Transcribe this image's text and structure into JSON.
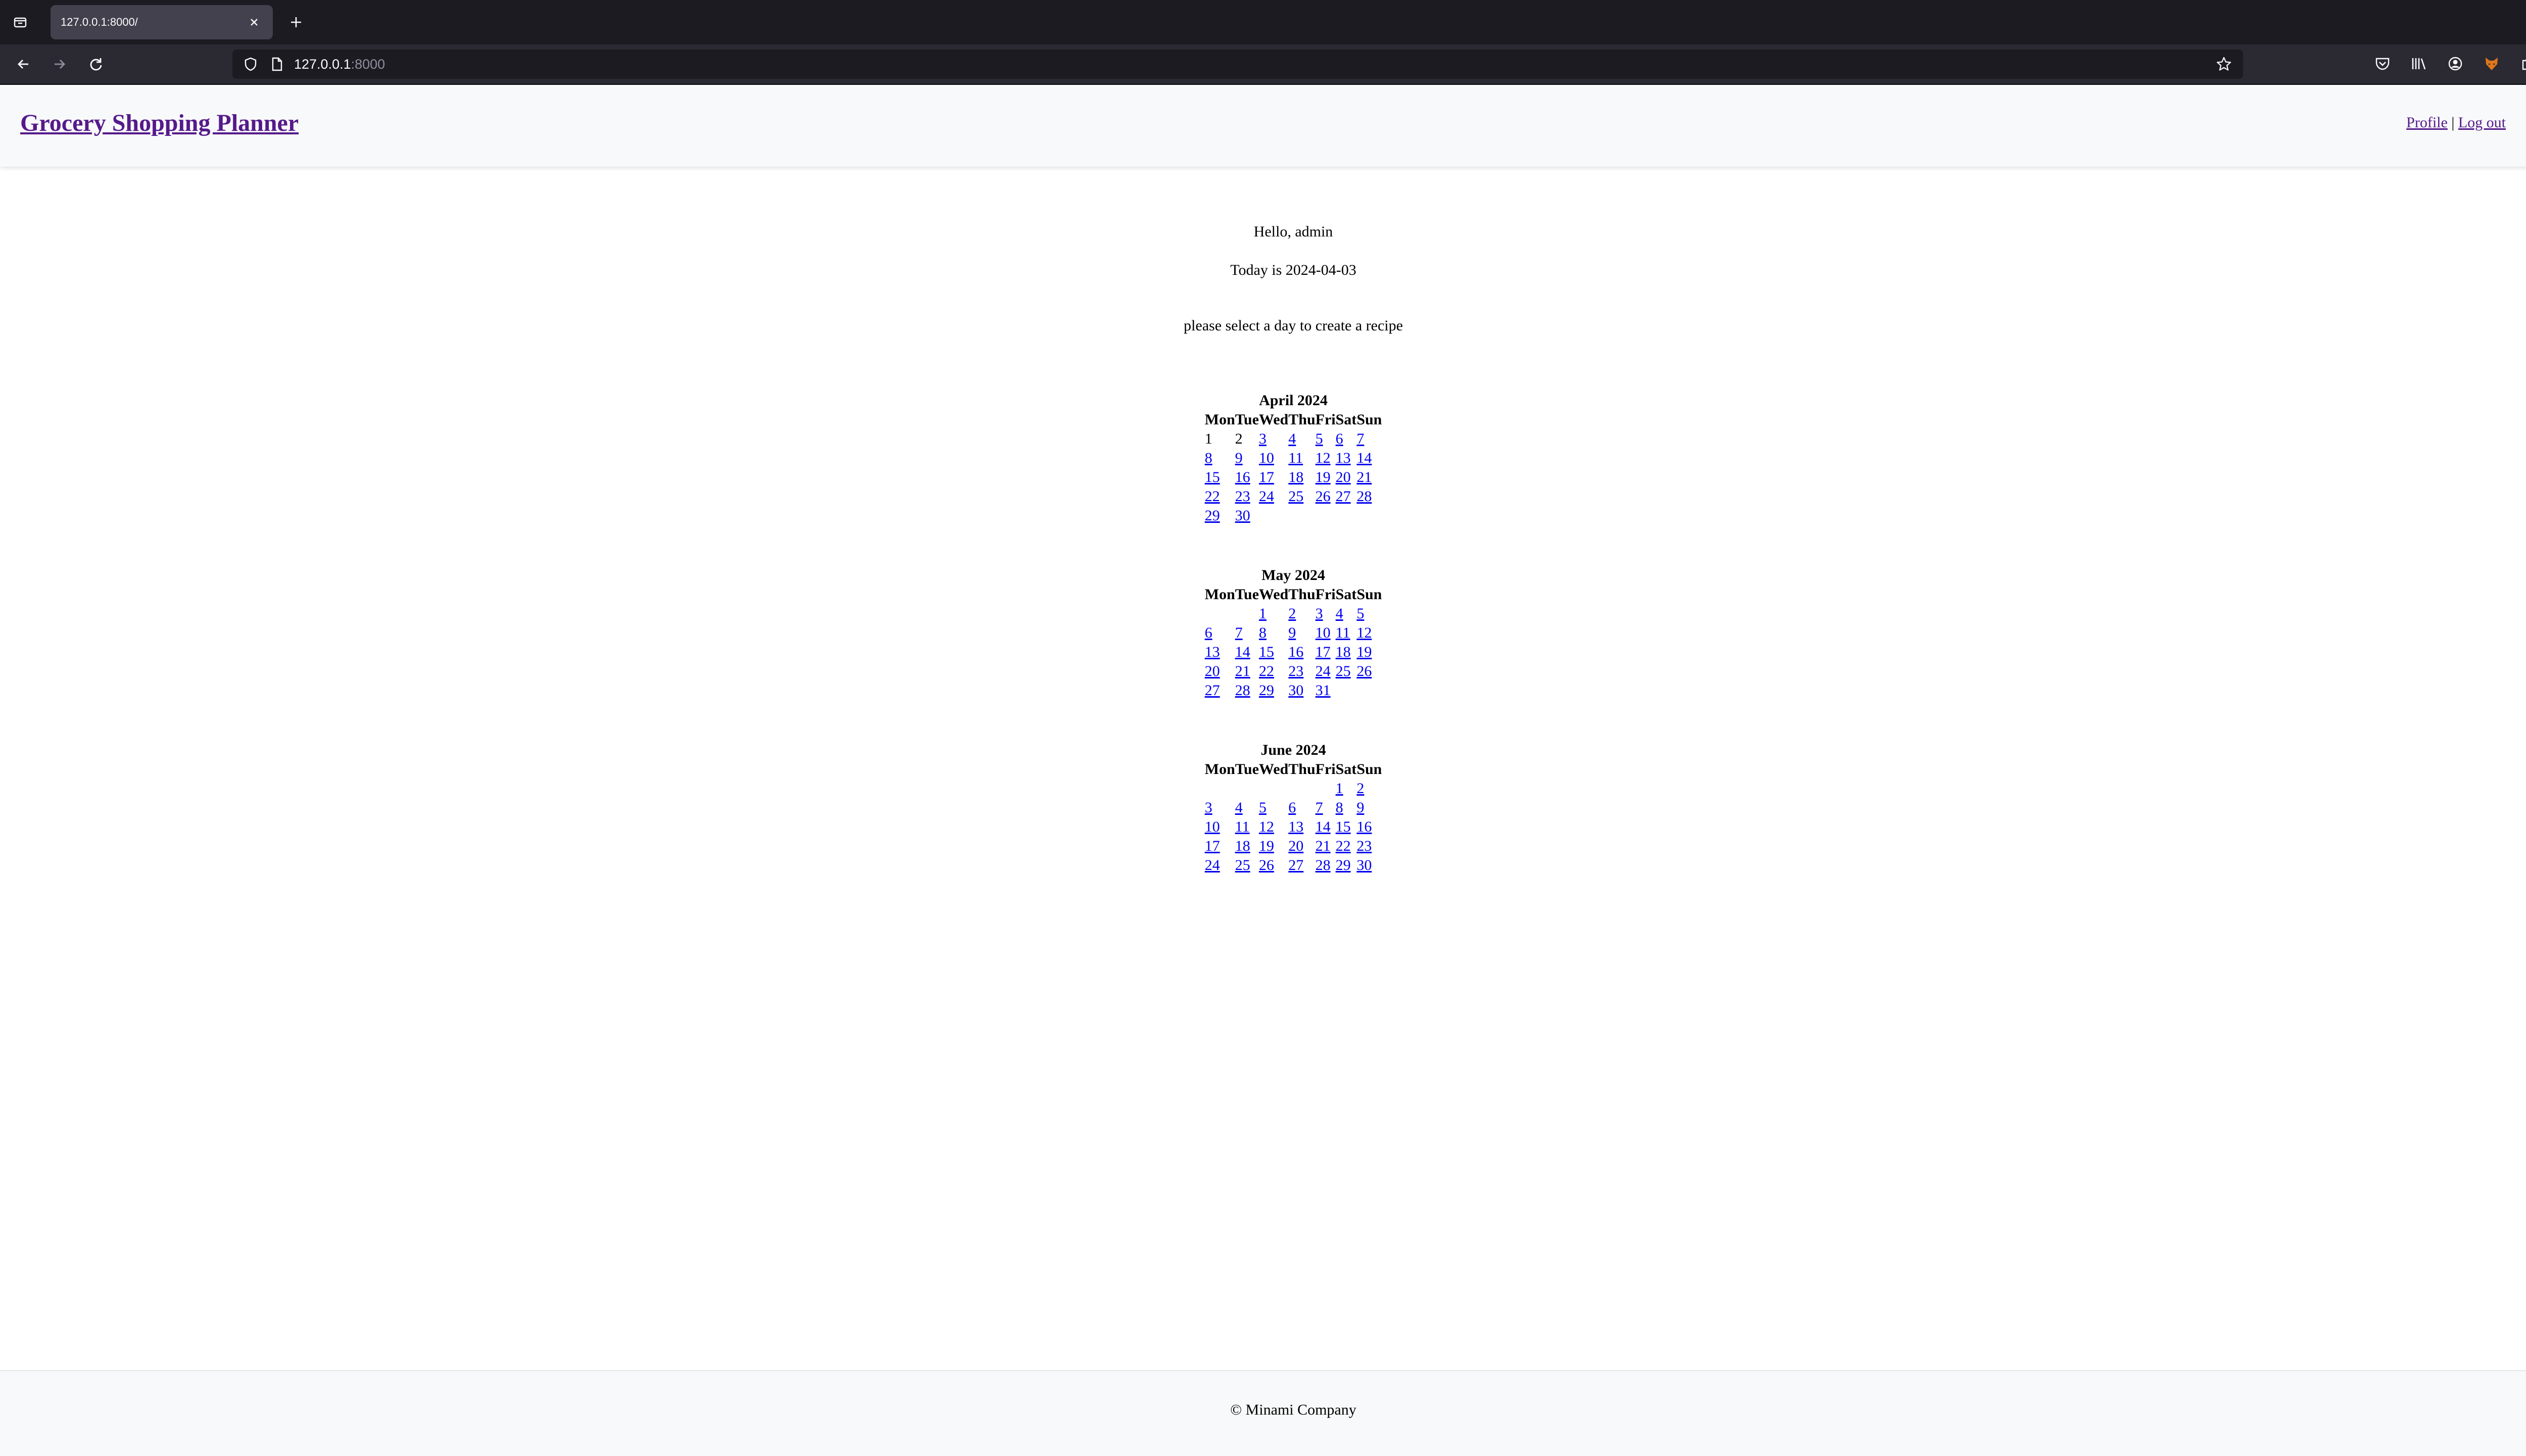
{
  "browser": {
    "tab_title": "127.0.0.1:8000/",
    "url_host": "127.0.0.1",
    "url_port": ":8000"
  },
  "header": {
    "title": "Grocery Shopping Planner",
    "profile_link": "Profile",
    "separator": "|",
    "logout_link": "Log out"
  },
  "main": {
    "greeting": "Hello, admin",
    "today": "Today is 2024-04-03",
    "instruction": "please select a day to create a recipe"
  },
  "calendars": [
    {
      "title": "April 2024",
      "weekdays": [
        "Mon",
        "Tue",
        "Wed",
        "Thu",
        "Fri",
        "Sat",
        "Sun"
      ],
      "weeks": [
        [
          {
            "d": "1",
            "link": false
          },
          {
            "d": "2",
            "link": false
          },
          {
            "d": "3",
            "link": true
          },
          {
            "d": "4",
            "link": true
          },
          {
            "d": "5",
            "link": true
          },
          {
            "d": "6",
            "link": true
          },
          {
            "d": "7",
            "link": true
          }
        ],
        [
          {
            "d": "8",
            "link": true
          },
          {
            "d": "9",
            "link": true
          },
          {
            "d": "10",
            "link": true
          },
          {
            "d": "11",
            "link": true
          },
          {
            "d": "12",
            "link": true
          },
          {
            "d": "13",
            "link": true
          },
          {
            "d": "14",
            "link": true
          }
        ],
        [
          {
            "d": "15",
            "link": true
          },
          {
            "d": "16",
            "link": true
          },
          {
            "d": "17",
            "link": true
          },
          {
            "d": "18",
            "link": true
          },
          {
            "d": "19",
            "link": true
          },
          {
            "d": "20",
            "link": true
          },
          {
            "d": "21",
            "link": true
          }
        ],
        [
          {
            "d": "22",
            "link": true
          },
          {
            "d": "23",
            "link": true
          },
          {
            "d": "24",
            "link": true
          },
          {
            "d": "25",
            "link": true
          },
          {
            "d": "26",
            "link": true
          },
          {
            "d": "27",
            "link": true
          },
          {
            "d": "28",
            "link": true
          }
        ],
        [
          {
            "d": "29",
            "link": true
          },
          {
            "d": "30",
            "link": true
          },
          {
            "d": "",
            "link": false
          },
          {
            "d": "",
            "link": false
          },
          {
            "d": "",
            "link": false
          },
          {
            "d": "",
            "link": false
          },
          {
            "d": "",
            "link": false
          }
        ]
      ]
    },
    {
      "title": "May 2024",
      "weekdays": [
        "Mon",
        "Tue",
        "Wed",
        "Thu",
        "Fri",
        "Sat",
        "Sun"
      ],
      "weeks": [
        [
          {
            "d": "",
            "link": false
          },
          {
            "d": "",
            "link": false
          },
          {
            "d": "1",
            "link": true
          },
          {
            "d": "2",
            "link": true
          },
          {
            "d": "3",
            "link": true
          },
          {
            "d": "4",
            "link": true
          },
          {
            "d": "5",
            "link": true
          }
        ],
        [
          {
            "d": "6",
            "link": true
          },
          {
            "d": "7",
            "link": true
          },
          {
            "d": "8",
            "link": true
          },
          {
            "d": "9",
            "link": true
          },
          {
            "d": "10",
            "link": true
          },
          {
            "d": "11",
            "link": true
          },
          {
            "d": "12",
            "link": true
          }
        ],
        [
          {
            "d": "13",
            "link": true
          },
          {
            "d": "14",
            "link": true
          },
          {
            "d": "15",
            "link": true
          },
          {
            "d": "16",
            "link": true
          },
          {
            "d": "17",
            "link": true
          },
          {
            "d": "18",
            "link": true
          },
          {
            "d": "19",
            "link": true
          }
        ],
        [
          {
            "d": "20",
            "link": true
          },
          {
            "d": "21",
            "link": true
          },
          {
            "d": "22",
            "link": true
          },
          {
            "d": "23",
            "link": true
          },
          {
            "d": "24",
            "link": true
          },
          {
            "d": "25",
            "link": true
          },
          {
            "d": "26",
            "link": true
          }
        ],
        [
          {
            "d": "27",
            "link": true
          },
          {
            "d": "28",
            "link": true
          },
          {
            "d": "29",
            "link": true
          },
          {
            "d": "30",
            "link": true
          },
          {
            "d": "31",
            "link": true
          },
          {
            "d": "",
            "link": false
          },
          {
            "d": "",
            "link": false
          }
        ]
      ]
    },
    {
      "title": "June 2024",
      "weekdays": [
        "Mon",
        "Tue",
        "Wed",
        "Thu",
        "Fri",
        "Sat",
        "Sun"
      ],
      "weeks": [
        [
          {
            "d": "",
            "link": false
          },
          {
            "d": "",
            "link": false
          },
          {
            "d": "",
            "link": false
          },
          {
            "d": "",
            "link": false
          },
          {
            "d": "",
            "link": false
          },
          {
            "d": "1",
            "link": true
          },
          {
            "d": "2",
            "link": true
          }
        ],
        [
          {
            "d": "3",
            "link": true
          },
          {
            "d": "4",
            "link": true
          },
          {
            "d": "5",
            "link": true
          },
          {
            "d": "6",
            "link": true
          },
          {
            "d": "7",
            "link": true
          },
          {
            "d": "8",
            "link": true
          },
          {
            "d": "9",
            "link": true
          }
        ],
        [
          {
            "d": "10",
            "link": true
          },
          {
            "d": "11",
            "link": true
          },
          {
            "d": "12",
            "link": true
          },
          {
            "d": "13",
            "link": true
          },
          {
            "d": "14",
            "link": true
          },
          {
            "d": "15",
            "link": true
          },
          {
            "d": "16",
            "link": true
          }
        ],
        [
          {
            "d": "17",
            "link": true
          },
          {
            "d": "18",
            "link": true
          },
          {
            "d": "19",
            "link": true
          },
          {
            "d": "20",
            "link": true
          },
          {
            "d": "21",
            "link": true
          },
          {
            "d": "22",
            "link": true
          },
          {
            "d": "23",
            "link": true
          }
        ],
        [
          {
            "d": "24",
            "link": true
          },
          {
            "d": "25",
            "link": true
          },
          {
            "d": "26",
            "link": true
          },
          {
            "d": "27",
            "link": true
          },
          {
            "d": "28",
            "link": true
          },
          {
            "d": "29",
            "link": true
          },
          {
            "d": "30",
            "link": true
          }
        ]
      ]
    }
  ],
  "footer": {
    "text": "© Minami Company"
  },
  "colors": {
    "link_unvisited": "#0000ee",
    "link_visited": "#551a8b",
    "header_bg": "#f8f9fa",
    "chrome_dark": "#1c1b22"
  },
  "icons": {
    "tab_list": "tab-list-icon",
    "tab_close": "close-icon",
    "new_tab": "plus-icon",
    "list_all_tabs": "chevron-down-icon",
    "back": "back-arrow-icon",
    "forward": "forward-arrow-icon",
    "reload": "reload-icon",
    "tracking_protection": "shield-icon",
    "page_info": "page-icon",
    "bookmark": "star-icon",
    "pocket": "pocket-icon",
    "library": "library-icon",
    "account": "account-icon",
    "extension_fox": "fox-extension-icon",
    "extensions": "puzzle-icon",
    "menu": "hamburger-menu-icon"
  }
}
